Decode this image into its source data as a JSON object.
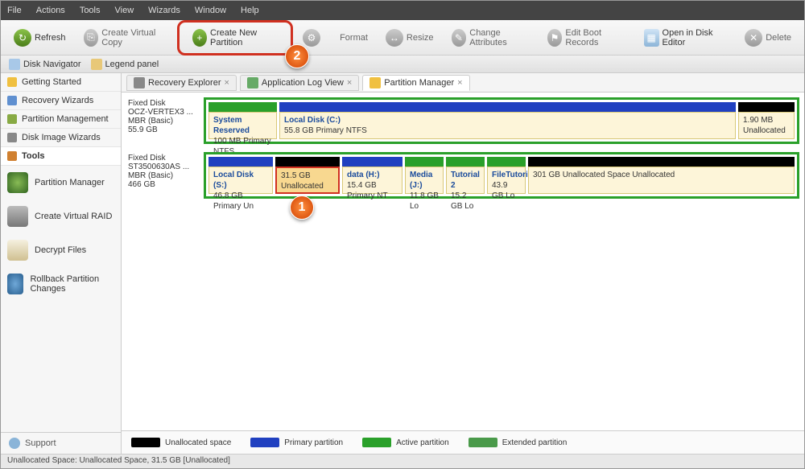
{
  "menu": [
    "File",
    "Actions",
    "Tools",
    "View",
    "Wizards",
    "Window",
    "Help"
  ],
  "toolbar": {
    "refresh": "Refresh",
    "cvc": "Create Virtual Copy",
    "cnp": "Create New Partition",
    "fmt": "Format",
    "rsz": "Resize",
    "cha": "Change Attributes",
    "ebr": "Edit Boot Records",
    "ode": "Open in Disk Editor",
    "del": "Delete"
  },
  "panelbar": {
    "dn": "Disk Navigator",
    "lp": "Legend panel"
  },
  "nav": {
    "gs": "Getting Started",
    "rw": "Recovery Wizards",
    "pm": "Partition Management",
    "diw": "Disk Image Wizards",
    "tools": "Tools"
  },
  "tools": {
    "pm": "Partition Manager",
    "cvr": "Create Virtual RAID",
    "df": "Decrypt Files",
    "rpc": "Rollback Partition Changes"
  },
  "tabs": {
    "re": "Recovery Explorer",
    "alv": "Application Log View",
    "pmt": "Partition Manager"
  },
  "disk1": {
    "info": "Fixed Disk\nOCZ-VERTEX3 ...\nMBR (Basic)\n55.9 GB",
    "p1t": "System Reserved",
    "p1s": "100 MB Primary NTFS",
    "p2t": "Local Disk (C:)",
    "p2s": "55.8 GB Primary NTFS",
    "p3s": "1.90 MB Unallocated"
  },
  "disk2": {
    "info": "Fixed Disk\nST3500630AS ...\nMBR (Basic)\n466 GB",
    "p1t": "Local Disk (S:)",
    "p1s": "46.8 GB Primary Un",
    "p2s": "31.5 GB Unallocated",
    "p3t": "data (H:)",
    "p3s": "15.4 GB Primary NT",
    "p4t": "Media (J:)",
    "p4s": "11.8 GB Lo",
    "p5t": "Tutorial 2",
    "p5s": "15.2 GB Lo",
    "p6t": "FileTutoria",
    "p6s": "43.9 GB Lo",
    "p7s": "301 GB Unallocated Space Unallocated"
  },
  "legend": {
    "u": "Unallocated space",
    "p": "Primary partition",
    "a": "Active partition",
    "e": "Extended partition"
  },
  "support": "Support",
  "status": "Unallocated Space: Unallocated Space, 31.5 GB [Unallocated]",
  "callout1": "1",
  "callout2": "2"
}
